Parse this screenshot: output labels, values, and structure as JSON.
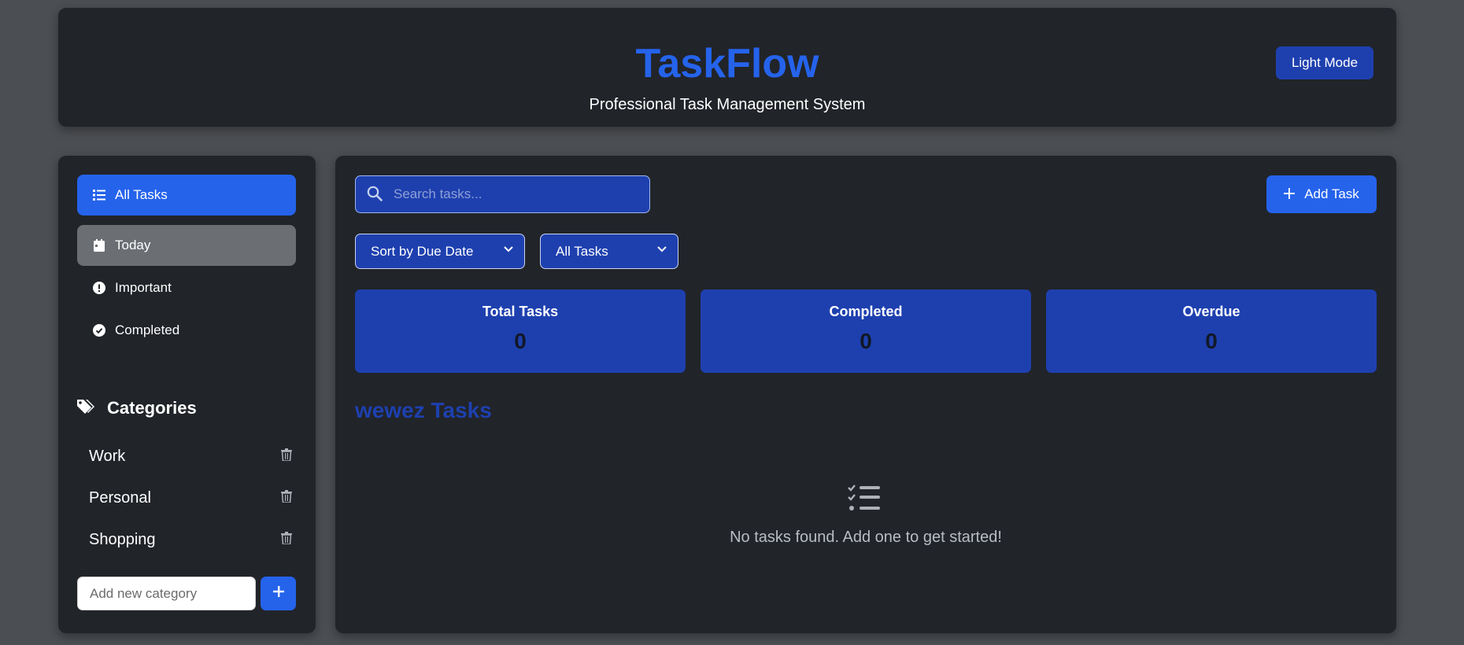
{
  "header": {
    "title": "TaskFlow",
    "subtitle": "Professional Task Management System",
    "theme_button": "Light Mode"
  },
  "sidebar": {
    "nav": [
      {
        "label": "All Tasks",
        "icon": "list-icon",
        "state": "active"
      },
      {
        "label": "Today",
        "icon": "calendar-icon",
        "state": "hover"
      },
      {
        "label": "Important",
        "icon": "exclamation-circle-icon",
        "state": "normal"
      },
      {
        "label": "Completed",
        "icon": "check-circle-icon",
        "state": "normal"
      }
    ],
    "categories_heading": "Categories",
    "categories": [
      {
        "label": "Work",
        "icon": "trash-icon"
      },
      {
        "label": "Personal",
        "icon": "trash-icon"
      },
      {
        "label": "Shopping",
        "icon": "trash-icon"
      }
    ],
    "new_category_placeholder": "Add new category",
    "add_category_icon": "plus-icon"
  },
  "main": {
    "search_placeholder": "Search tasks...",
    "add_task_label": "Add Task",
    "sort_select": {
      "selected": "Sort by Due Date"
    },
    "filter_select": {
      "selected": "All Tasks"
    },
    "stats": [
      {
        "label": "Total Tasks",
        "value": "0"
      },
      {
        "label": "Completed",
        "value": "0"
      },
      {
        "label": "Overdue",
        "value": "0"
      }
    ],
    "list_title": "wewez Tasks",
    "empty_icon": "tasks-list-icon",
    "empty_message": "No tasks found. Add one to get started!"
  },
  "colors": {
    "page_background": "#4b4e52",
    "panel": "#212429",
    "accent": "#2563eb",
    "accent_dark": "#1e40af",
    "nav_hover": "#6b6e73"
  }
}
